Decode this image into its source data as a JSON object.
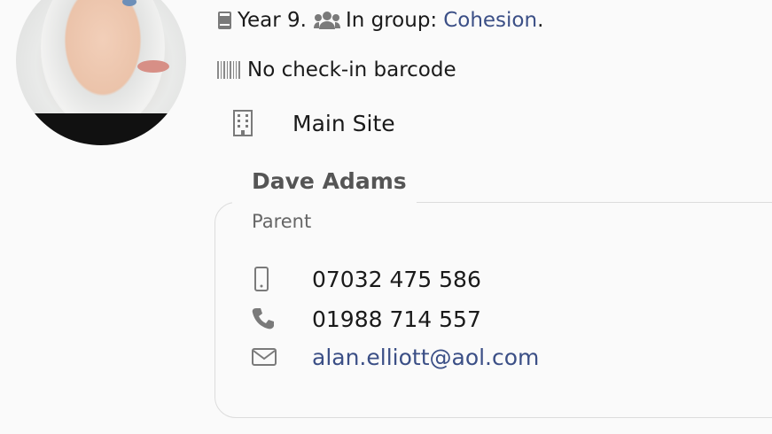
{
  "profile": {
    "avatar_alt": "student photo",
    "year_text": "Year 9.",
    "group_prefix": "In group:",
    "group_name": "Cohesion",
    "group_suffix": ".",
    "barcode_text": "No check-in barcode",
    "site": "Main Site"
  },
  "contact": {
    "name": "Dave Adams",
    "role": "Parent",
    "mobile": "07032 475 586",
    "phone": "01988 714 557",
    "email": "alan.elliott@aol.com"
  },
  "colors": {
    "link": "#3b4f86",
    "icon": "#7a7a7a"
  }
}
